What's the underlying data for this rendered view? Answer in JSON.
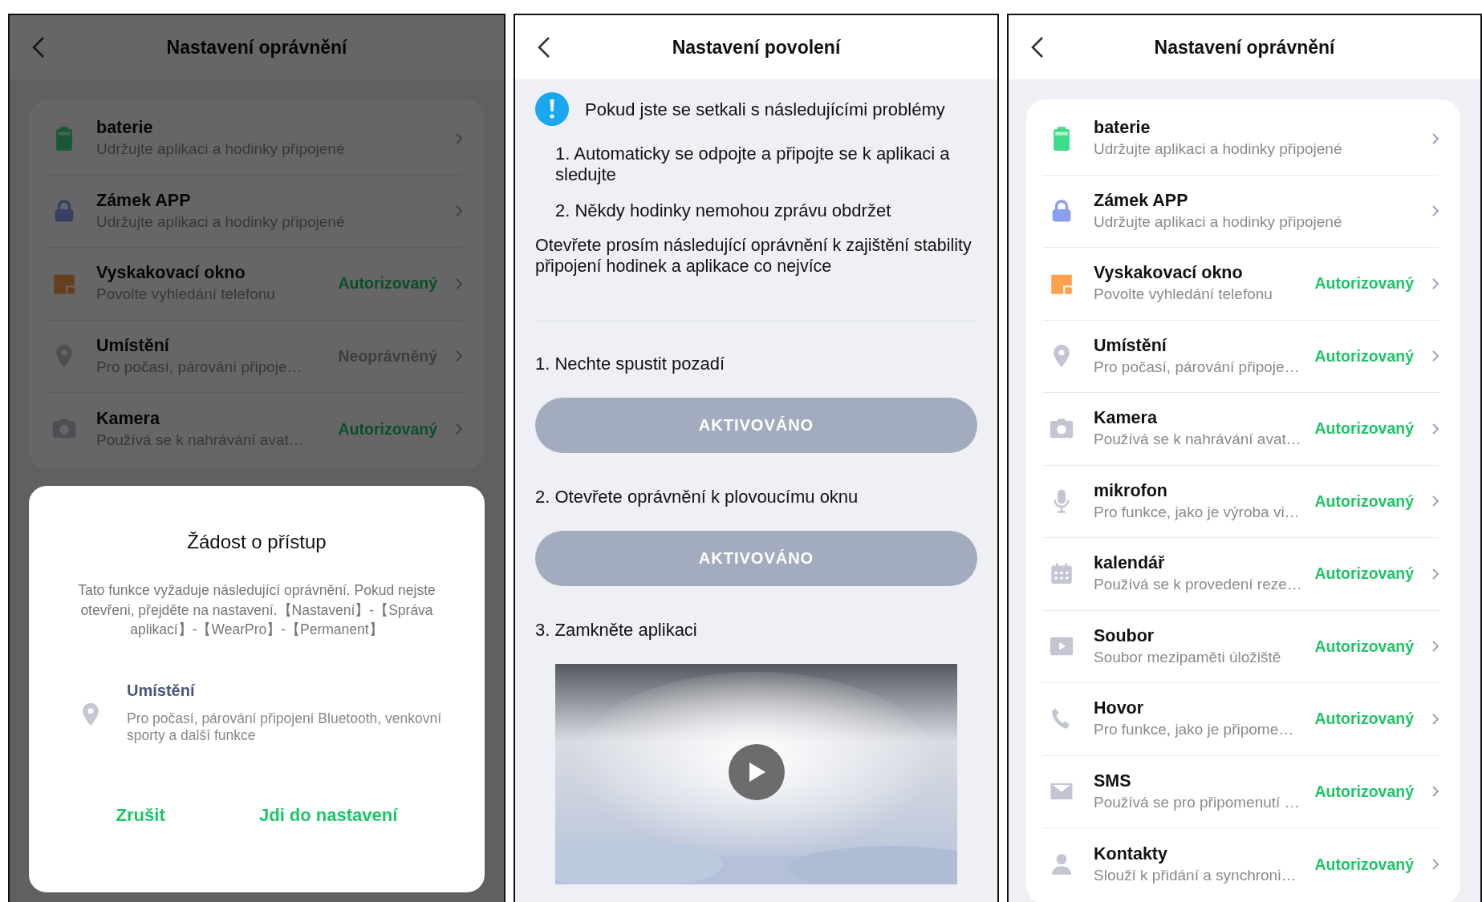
{
  "left_screen": {
    "title": "Nastavení oprávnění",
    "items": [
      {
        "kind": "battery",
        "title": "baterie",
        "subtitle": "Udržujte aplikaci a hodinky připojené"
      },
      {
        "kind": "lock",
        "title": "Zámek APP",
        "subtitle": "Udržujte aplikaci a hodinky připojené"
      },
      {
        "kind": "window",
        "title": "Vyskakovací okno",
        "subtitle": "Povolte vyhledání telefonu",
        "status": "Autorizovaný",
        "granted": true
      },
      {
        "kind": "pin",
        "title": "Umístění",
        "subtitle": "Pro počasí, párování připoje…",
        "status": "Neoprávněný",
        "granted": false
      },
      {
        "kind": "camera",
        "title": "Kamera",
        "subtitle": "Používá se k nahrávání avat…",
        "status": "Autorizovaný",
        "granted": true
      }
    ],
    "dialog": {
      "title": "Žádost o přístup",
      "message": "Tato funkce vyžaduje následující oprávnění. Pokud nejste otevřeni, přejděte na nastavení.【Nastavení】-【Správa aplikací】-【WearPro】-【Permanent】",
      "permission": {
        "kind": "pin",
        "title": "Umístění",
        "description": "Pro počasí, párování připojení Bluetooth, venkovní sporty a další funkce"
      },
      "buttons": [
        "Zrušit",
        "Jdi do nastavení"
      ]
    }
  },
  "middle_screen": {
    "title": "Nastavení povolení",
    "notice": "Pokud jste se setkali s následujícími problémy",
    "problems": [
      "1. Automaticky se odpojte a připojte se k aplikaci a sledujte",
      "2. Někdy hodinky nemohou zprávu obdržet"
    ],
    "instruction": "Otevřete prosím následující oprávnění k zajištění stability připojení hodinek a aplikace co nejvíce",
    "steps": [
      {
        "label": "1. Nechte spustit pozadí",
        "button": {
          "label": "AKTIVOVÁNO",
          "disabled": true
        }
      },
      {
        "label": "2. Otevřete oprávnění k plovoucímu oknu",
        "button": {
          "label": "AKTIVOVÁNO",
          "disabled": true
        }
      },
      {
        "label": "3. Zamkněte aplikaci"
      }
    ]
  },
  "right_screen": {
    "title": "Nastavení oprávnění",
    "items": [
      {
        "kind": "battery",
        "title": "baterie",
        "subtitle": "Udržujte aplikaci a hodinky připojené"
      },
      {
        "kind": "lock",
        "title": "Zámek APP",
        "subtitle": "Udržujte aplikaci a hodinky připojené"
      },
      {
        "kind": "window",
        "title": "Vyskakovací okno",
        "subtitle": "Povolte vyhledání telefonu",
        "status": "Autorizovaný",
        "granted": true
      },
      {
        "kind": "pin",
        "title": "Umístění",
        "subtitle": "Pro počasí, párování připoje…",
        "status": "Autorizovaný",
        "granted": true
      },
      {
        "kind": "camera",
        "title": "Kamera",
        "subtitle": "Používá se k nahrávání avat…",
        "status": "Autorizovaný",
        "granted": true
      },
      {
        "kind": "mic",
        "title": "mikrofon",
        "subtitle": "Pro funkce, jako je výroba vi…",
        "status": "Autorizovaný",
        "granted": true
      },
      {
        "kind": "calendar",
        "title": "kalendář",
        "subtitle": "Používá se k provedení reze…",
        "status": "Autorizovaný",
        "granted": true
      },
      {
        "kind": "film",
        "title": "Soubor",
        "subtitle": "Soubor mezipaměti úložiště",
        "status": "Autorizovaný",
        "granted": true
      },
      {
        "kind": "phone",
        "title": "Hovor",
        "subtitle": "Pro funkce, jako je připome…",
        "status": "Autorizovaný",
        "granted": true
      },
      {
        "kind": "envelope",
        "title": "SMS",
        "subtitle": "Používá se pro připomenutí …",
        "status": "Autorizovaný",
        "granted": true
      },
      {
        "kind": "person",
        "title": "Kontakty",
        "subtitle": "Slouží k přidání a synchroni…",
        "status": "Autorizovaný",
        "granted": true
      }
    ]
  }
}
